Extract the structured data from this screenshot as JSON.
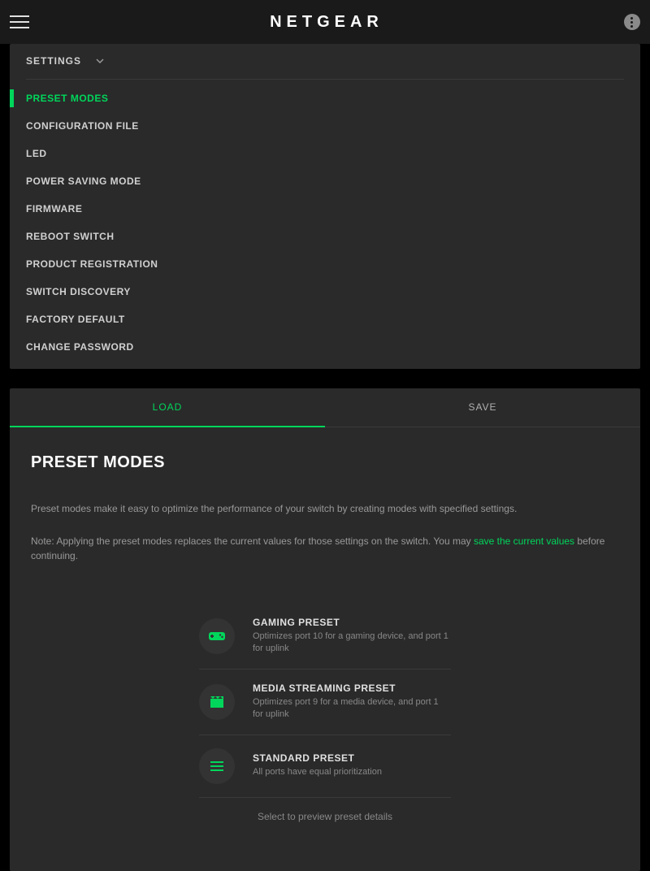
{
  "header": {
    "logo": "NETGEAR"
  },
  "settings": {
    "header_label": "SETTINGS",
    "items": [
      {
        "label": "PRESET MODES",
        "active": true
      },
      {
        "label": "CONFIGURATION FILE",
        "active": false
      },
      {
        "label": "LED",
        "active": false
      },
      {
        "label": "POWER SAVING MODE",
        "active": false
      },
      {
        "label": "FIRMWARE",
        "active": false
      },
      {
        "label": "REBOOT SWITCH",
        "active": false
      },
      {
        "label": "PRODUCT REGISTRATION",
        "active": false
      },
      {
        "label": "SWITCH DISCOVERY",
        "active": false
      },
      {
        "label": "FACTORY DEFAULT",
        "active": false
      },
      {
        "label": "CHANGE PASSWORD",
        "active": false
      }
    ]
  },
  "tabs": {
    "load": "LOAD",
    "save": "SAVE"
  },
  "content": {
    "title": "PRESET MODES",
    "intro": "Preset modes make it easy to optimize the performance of your switch by creating modes with specified settings.",
    "note_prefix": "Note: Applying the preset modes replaces the current values for those settings on the switch. You may ",
    "note_link": "save the current values",
    "note_suffix": " before continuing.",
    "footer": "Select to preview preset details"
  },
  "presets": [
    {
      "title": "GAMING PRESET",
      "desc": "Optimizes port 10 for a gaming device, and port 1 for uplink",
      "icon": "gamepad"
    },
    {
      "title": "MEDIA STREAMING PRESET",
      "desc": "Optimizes port 9 for a media device, and port 1 for uplink",
      "icon": "movie"
    },
    {
      "title": "STANDARD PRESET",
      "desc": "All ports have equal prioritization",
      "icon": "lines"
    }
  ]
}
